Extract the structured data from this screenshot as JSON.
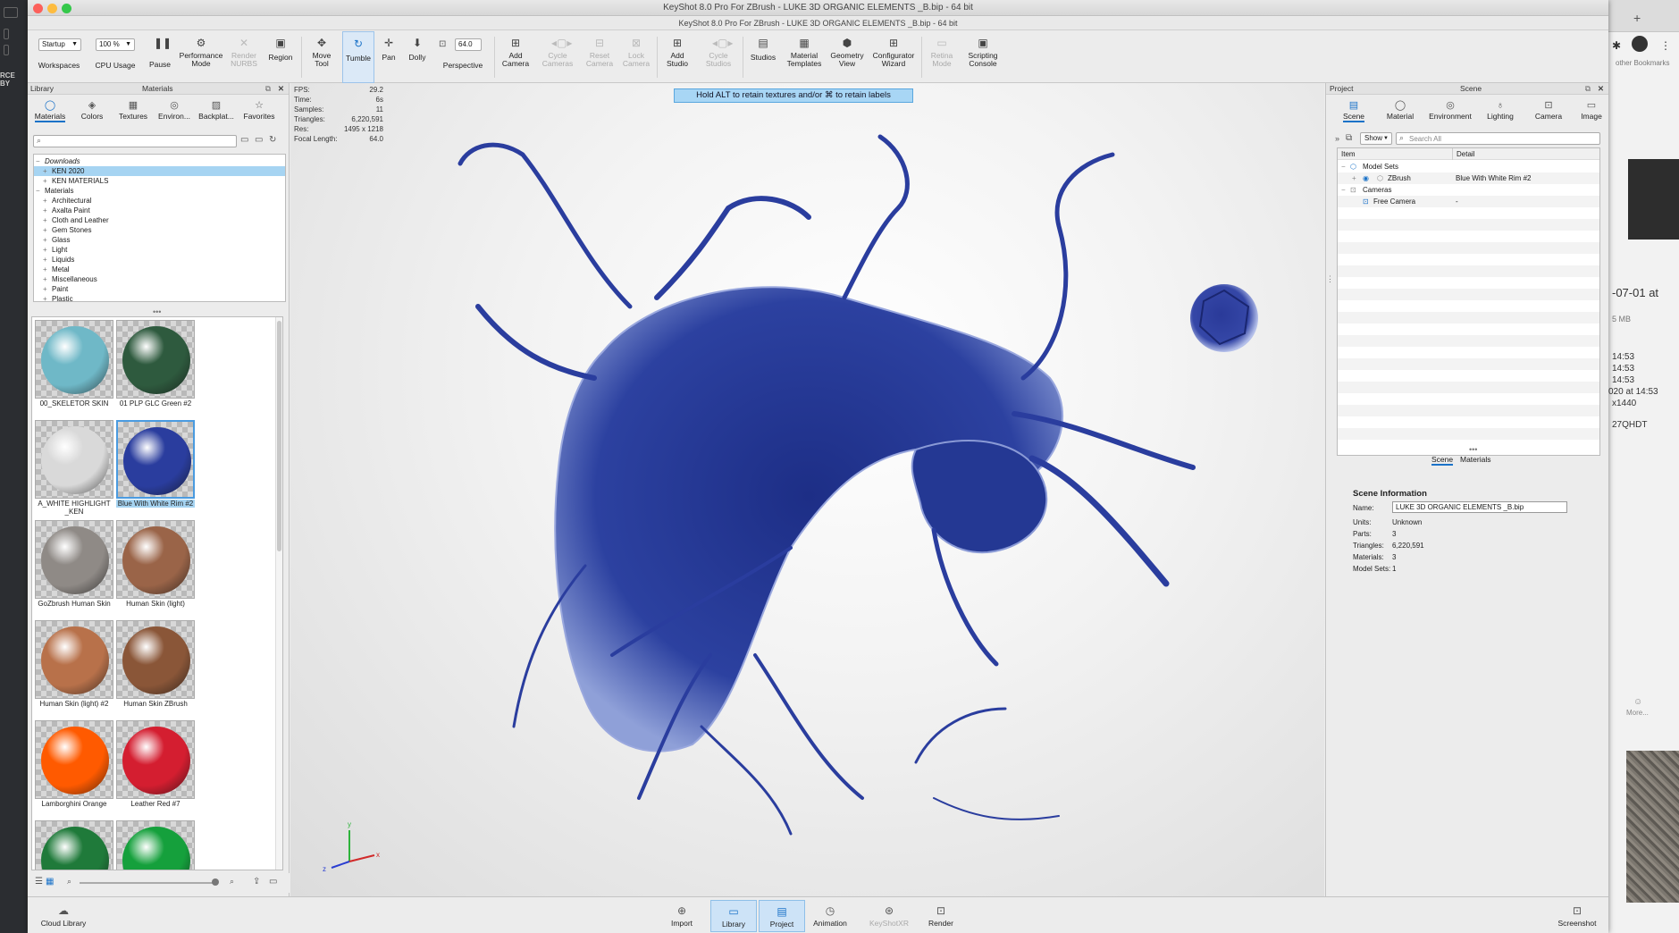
{
  "window": {
    "title": "KeyShot 8.0 Pro For ZBrush - LUKE 3D ORGANIC ELEMENTS _B.bip  - 64 bit",
    "subtitle": "KeyShot 8.0 Pro For ZBrush - LUKE 3D ORGANIC ELEMENTS _B.bip - 64 bit"
  },
  "desktop": {
    "left_text": "RCE BY",
    "right_texts": [
      "other Bookmarks",
      "-07-01 at",
      "5 MB",
      "14:53",
      "14:53",
      "14:53",
      "020 at 14:53",
      "x1440",
      "27QHDT",
      "More..."
    ]
  },
  "toolbar": {
    "workspace_select": "Startup",
    "workspaces": "Workspaces",
    "cpu_select": "100 %",
    "cpu_usage": "CPU Usage",
    "pause": "Pause",
    "performance_mode": "Performance Mode",
    "render_nurbs": "Render NURBS",
    "region": "Region",
    "move_tool": "Move Tool",
    "tumble": "Tumble",
    "pan": "Pan",
    "dolly": "Dolly",
    "fov_value": "64.0",
    "perspective": "Perspective",
    "add_camera": "Add Camera",
    "cycle_cameras": "Cycle Cameras",
    "reset_camera": "Reset Camera",
    "lock_camera": "Lock Camera",
    "add_studio": "Add Studio",
    "cycle_studios": "Cycle Studios",
    "studios": "Studios",
    "material_templates": "Material Templates",
    "geometry_view": "Geometry View",
    "configurator_wizard": "Configurator Wizard",
    "retina_mode": "Retina Mode",
    "scripting_console": "Scripting Console"
  },
  "library": {
    "header_left": "Library",
    "header_title": "Materials",
    "tabs": [
      "Materials",
      "Colors",
      "Textures",
      "Environ...",
      "Backplat...",
      "Favorites"
    ],
    "tree": [
      {
        "label": "Downloads",
        "level": 0,
        "selected": false
      },
      {
        "label": "KEN 2020",
        "level": 1,
        "selected": true
      },
      {
        "label": "KEN MATERIALS",
        "level": 1,
        "selected": false
      },
      {
        "label": "Materials",
        "level": 0,
        "selected": false
      },
      {
        "label": "Architectural",
        "level": 1,
        "selected": false
      },
      {
        "label": "Axalta Paint",
        "level": 1,
        "selected": false
      },
      {
        "label": "Cloth and Leather",
        "level": 1,
        "selected": false
      },
      {
        "label": "Gem Stones",
        "level": 1,
        "selected": false
      },
      {
        "label": "Glass",
        "level": 1,
        "selected": false
      },
      {
        "label": "Light",
        "level": 1,
        "selected": false
      },
      {
        "label": "Liquids",
        "level": 1,
        "selected": false
      },
      {
        "label": "Metal",
        "level": 1,
        "selected": false
      },
      {
        "label": "Miscellaneous",
        "level": 1,
        "selected": false
      },
      {
        "label": "Paint",
        "level": 1,
        "selected": false
      },
      {
        "label": "Plastic",
        "level": 1,
        "selected": false
      }
    ],
    "materials": [
      {
        "name": "00_SKELETOR SKIN",
        "color": "#6fb8c7"
      },
      {
        "name": "01 PLP GLC Green #2",
        "color": "#2e5a3e"
      },
      {
        "name": "A_WHITE HIGHLIGHT _KEN",
        "color": "#d9d9d9"
      },
      {
        "name": "Blue With White Rim #2",
        "color": "#2a3d9e"
      },
      {
        "name": "GoZbrush Human Skin",
        "color": "#8f8a86"
      },
      {
        "name": "Human Skin (light)",
        "color": "#9a6448"
      },
      {
        "name": "Human Skin (light) #2",
        "color": "#b8714a"
      },
      {
        "name": "Human Skin ZBrush",
        "color": "#8a5638"
      },
      {
        "name": "Lamborghini Orange",
        "color": "#ff5a00"
      },
      {
        "name": "Leather Red #7",
        "color": "#d41e30"
      },
      {
        "name": "",
        "color": "#1f7a3a"
      },
      {
        "name": "",
        "color": "#15a03c"
      }
    ],
    "footer": "Cloud Library"
  },
  "viewport": {
    "banner": "Hold ALT to retain textures and/or ⌘ to retain labels",
    "stats": [
      {
        "label": "FPS:",
        "value": "29.2"
      },
      {
        "label": "Time:",
        "value": "6s"
      },
      {
        "label": "Samples:",
        "value": "11"
      },
      {
        "label": "Triangles:",
        "value": "6,220,591"
      },
      {
        "label": "Res:",
        "value": "1495 x 1218"
      },
      {
        "label": "Focal Length:",
        "value": "64.0"
      }
    ]
  },
  "project": {
    "header_left": "Project",
    "header_title": "Scene",
    "tabs": [
      "Scene",
      "Material",
      "Environment",
      "Lighting",
      "Camera",
      "Image"
    ],
    "show_button": "Show",
    "search_placeholder": "Search All",
    "columns": [
      "Item",
      "Detail"
    ],
    "rows": [
      {
        "item": "Model Sets",
        "detail": ""
      },
      {
        "item": "ZBrush",
        "detail": "Blue With White Rim #2"
      },
      {
        "item": "Cameras",
        "detail": ""
      },
      {
        "item": "Free Camera",
        "detail": "-"
      }
    ],
    "subtabs": [
      "Scene",
      "Materials"
    ],
    "info": {
      "title": "Scene Information",
      "name_label": "Name:",
      "name_value": "LUKE 3D ORGANIC ELEMENTS _B.bip",
      "units_label": "Units:",
      "units_value": "Unknown",
      "parts_label": "Parts:",
      "parts_value": "3",
      "triangles_label": "Triangles:",
      "triangles_value": "6,220,591",
      "materials_label": "Materials:",
      "materials_value": "3",
      "modelsets_label": "Model Sets:",
      "modelsets_value": "1"
    }
  },
  "bottombar": {
    "import": "Import",
    "library": "Library",
    "project": "Project",
    "animation": "Animation",
    "keyshotxr": "KeyShotXR",
    "render": "Render",
    "screenshot": "Screenshot"
  },
  "colors": {
    "accent": "#1a72c8",
    "selection": "#a6d4f2",
    "model": "#2b3f9a"
  }
}
